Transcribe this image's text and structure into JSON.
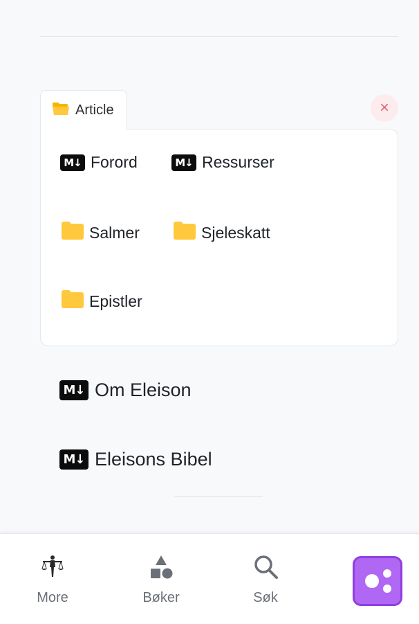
{
  "tab": {
    "label": "Article",
    "icon": "folder-open-icon"
  },
  "close": {
    "symbol": "×"
  },
  "explorer": {
    "items": [
      {
        "type": "markdown",
        "label": "Forord",
        "badge": "M↓"
      },
      {
        "type": "markdown",
        "label": "Ressurser",
        "badge": "M↓"
      },
      {
        "type": "folder",
        "label": "Salmer"
      },
      {
        "type": "folder",
        "label": "Sjeleskatt"
      },
      {
        "type": "folder",
        "label": "Epistler"
      }
    ]
  },
  "documents": [
    {
      "type": "markdown",
      "label": "Om Eleison",
      "badge": "M↓"
    },
    {
      "type": "markdown",
      "label": "Eleisons Bibel",
      "badge": "M↓"
    }
  ],
  "bottom_nav": {
    "items": [
      {
        "label": "More",
        "icon": "scales-figure-icon"
      },
      {
        "label": "Bøker",
        "icon": "shapes-icon"
      },
      {
        "label": "Søk",
        "icon": "search-icon"
      }
    ],
    "app_button_icon": "dots-app-icon"
  },
  "colors": {
    "folder": "#ffc107",
    "accent": "#b067f4",
    "close": "#e26b76"
  }
}
